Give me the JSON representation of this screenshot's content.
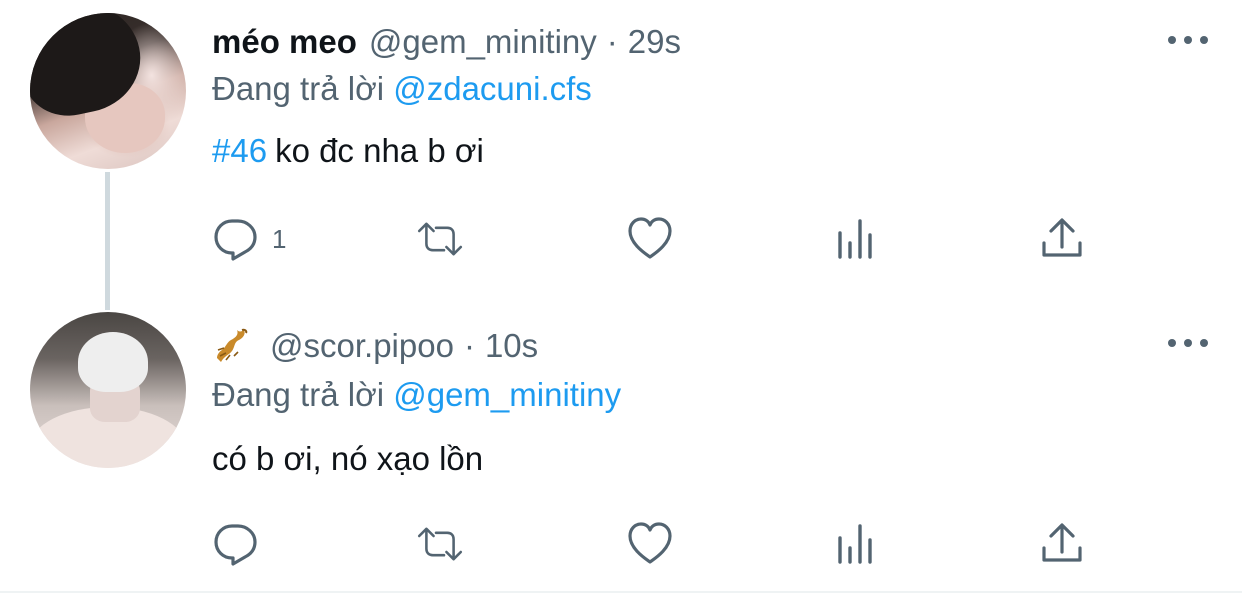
{
  "tweets": [
    {
      "display_name": "méo meo",
      "handle": "@gem_minitiny",
      "separator": "·",
      "time": "29s",
      "replying_prefix": "Đang trả lời",
      "replying_to": "@zdacuni.cfs",
      "hashtag": "#46",
      "text": "ko đc nha b ơi",
      "reply_count": "1"
    },
    {
      "name_emoji": "🦂",
      "handle": "@scor.pipoo",
      "separator": "·",
      "time": "10s",
      "replying_prefix": "Đang trả lời",
      "replying_to": "@gem_minitiny",
      "text": "có b ơi, nó xạo lồn",
      "reply_count": ""
    }
  ],
  "icons": {
    "reply": "reply-icon",
    "retweet": "retweet-icon",
    "like": "heart-icon",
    "views": "views-icon",
    "share": "share-icon",
    "more": "more-icon"
  },
  "colors": {
    "link": "#1d9bf0",
    "text": "#0f1419",
    "secondary": "#536471",
    "thread_line": "#cfd9de"
  }
}
